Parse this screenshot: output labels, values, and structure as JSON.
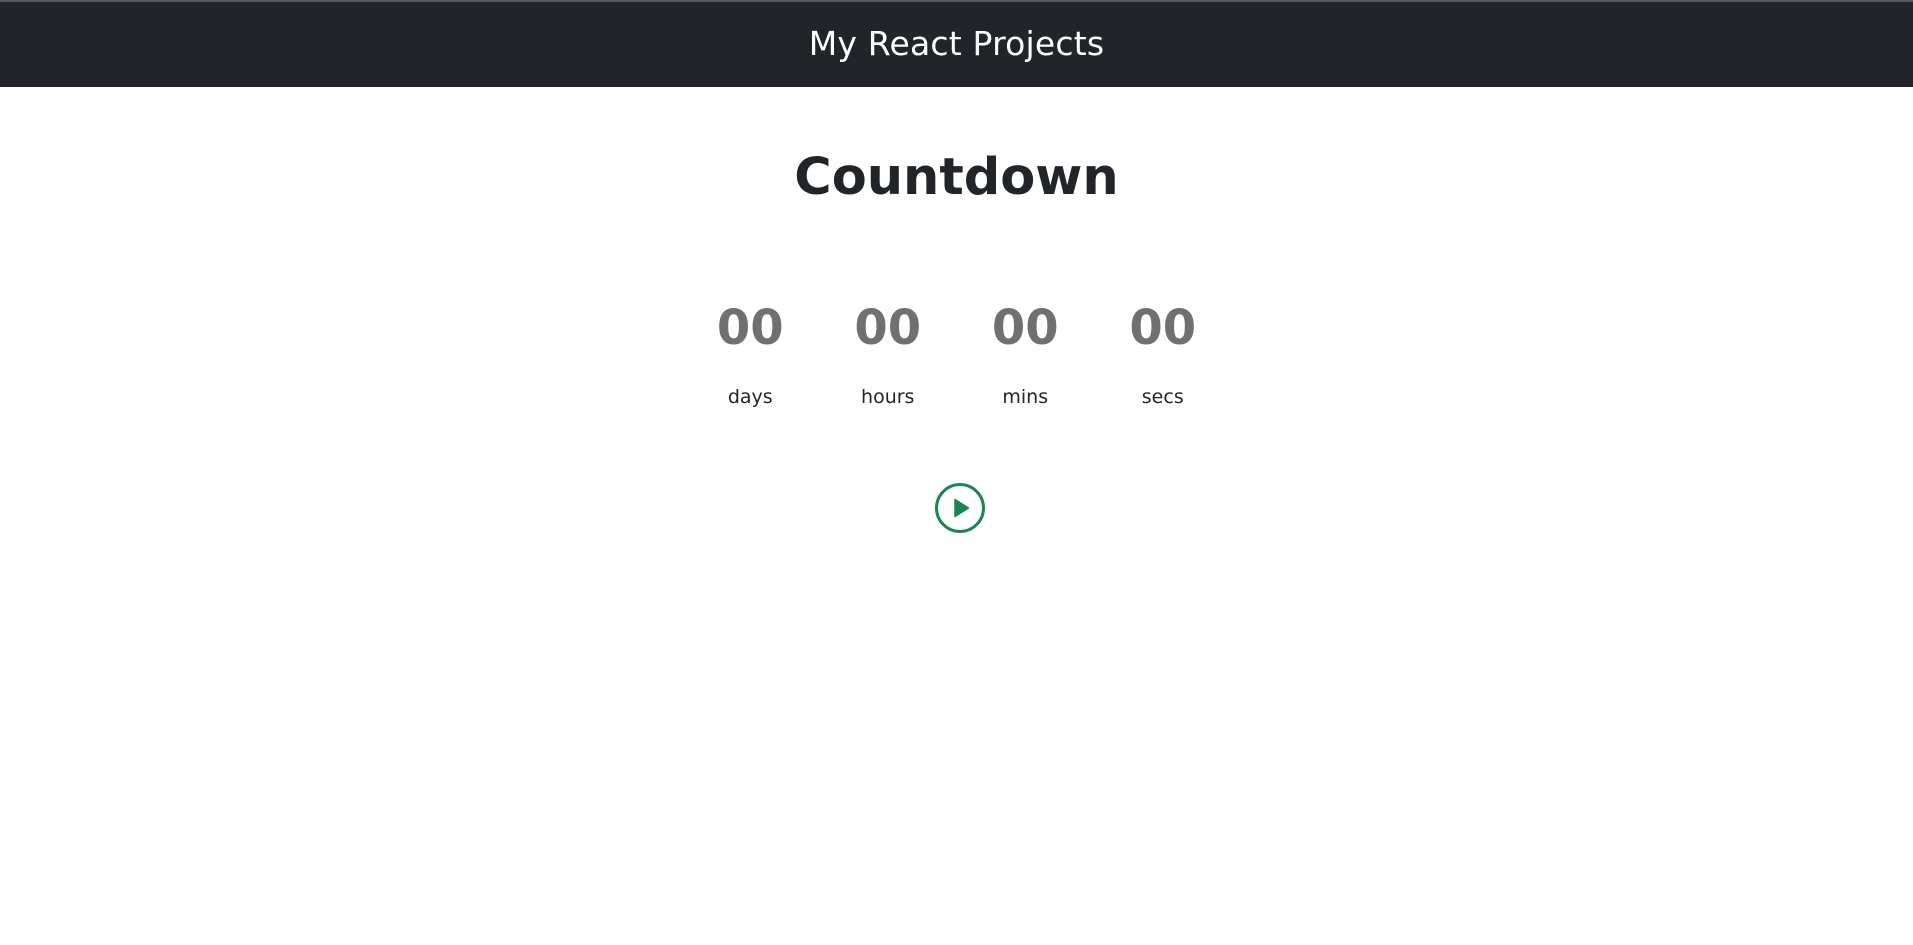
{
  "navbar": {
    "brand": "My React Projects"
  },
  "page": {
    "title": "Countdown"
  },
  "countdown": {
    "units": [
      {
        "value": "00",
        "label": "days"
      },
      {
        "value": "00",
        "label": "hours"
      },
      {
        "value": "00",
        "label": "mins"
      },
      {
        "value": "00",
        "label": "secs"
      }
    ]
  },
  "controls": {
    "play_icon": "play-circle-icon"
  },
  "colors": {
    "navbar_bg": "#212529",
    "digit": "#707070",
    "play_accent": "#198754"
  }
}
